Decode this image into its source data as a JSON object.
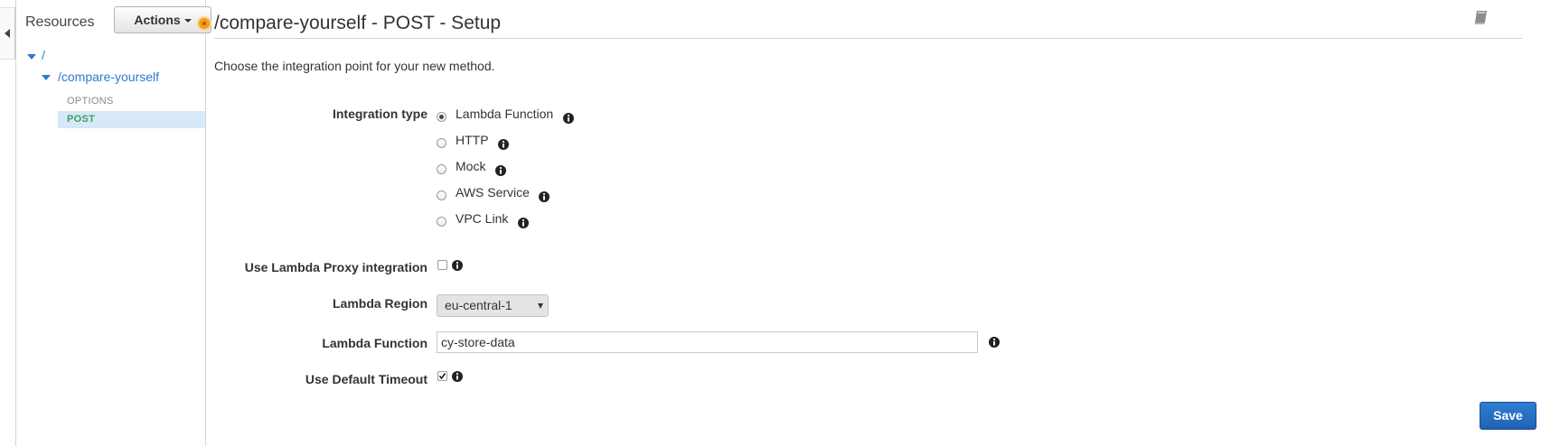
{
  "sidebar": {
    "title": "Resources",
    "actions_label": "Actions",
    "tree": {
      "root": "/",
      "child": "/compare-yourself",
      "methods": [
        "OPTIONS",
        "POST"
      ]
    }
  },
  "page": {
    "title": "/compare-yourself - POST - Setup",
    "subtitle": "Choose the integration point for your new method."
  },
  "form": {
    "integration_type_label": "Integration type",
    "integration_options": [
      "Lambda Function",
      "HTTP",
      "Mock",
      "AWS Service",
      "VPC Link"
    ],
    "selected_integration": "Lambda Function",
    "proxy_label": "Use Lambda Proxy integration",
    "proxy_checked": false,
    "region_label": "Lambda Region",
    "region_value": "eu-central-1",
    "function_label": "Lambda Function",
    "function_value": "cy-store-data",
    "timeout_label": "Use Default Timeout",
    "timeout_checked": true
  },
  "buttons": {
    "save": "Save"
  },
  "colors": {
    "accent": "#2f7ad1",
    "post_method": "#3aa654",
    "selected_row": "#d6e8fa",
    "save_button": "#1f63b5",
    "status_dot": "#f29c1a"
  }
}
